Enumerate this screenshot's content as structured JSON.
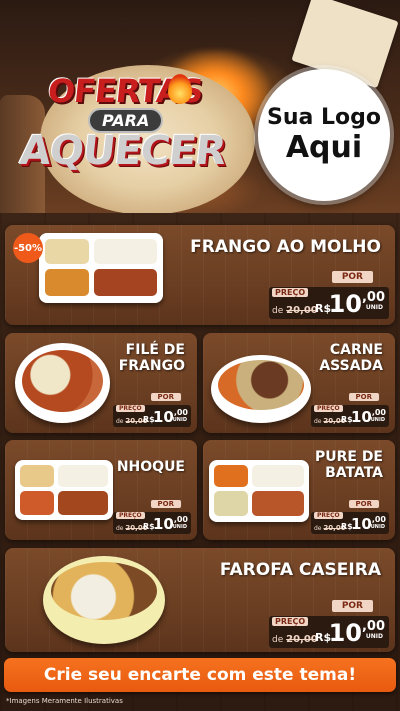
{
  "header": {
    "title_line1": "OFERTAS",
    "title_line2": "PARA",
    "title_line3": "AQUECER",
    "logo_line1": "Sua Logo",
    "logo_line2": "Aqui"
  },
  "labels": {
    "por": "POR",
    "preco": "PREÇO",
    "de": "de",
    "currency": "R$",
    "unit": "UNID",
    "old_price": "20,00",
    "price_int": "10",
    "price_cents": ",00"
  },
  "products": [
    {
      "name": "FRANGO AO MOLHO",
      "badge": "-50%"
    },
    {
      "name": "FILÉ DE FRANGO"
    },
    {
      "name": "CARNE ASSADA"
    },
    {
      "name": "NHOQUE"
    },
    {
      "name": "PURE DE BATATA"
    },
    {
      "name": "FAROFA CASEIRA"
    }
  ],
  "cta": "Crie seu encarte com este tema!",
  "disclaimer": "*Imagens Meramente Ilustrativas"
}
